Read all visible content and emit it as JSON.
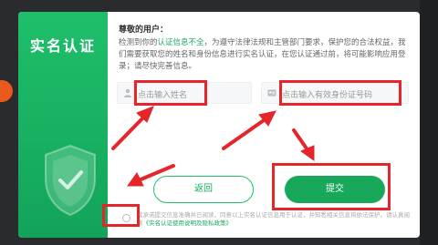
{
  "dialog": {
    "title": "实名认证",
    "greeting": "尊敬的用户：",
    "desc_prefix": "检测到你的",
    "desc_highlight": "认证信息不全",
    "desc_suffix": "，为遵守法律法规和主管部门要求，保护您的合法权益，我们需要获取您的姓名和身份信息进行实名认证，在您认证通过前，将可能影响应用登录；请尽快完善信息。"
  },
  "form": {
    "name_placeholder": "点击输入姓名",
    "id_placeholder": "点击输入有效身份证号码"
  },
  "buttons": {
    "back": "返回",
    "submit": "提交"
  },
  "agreement": {
    "prefix": "我承诺提交信息准确并已阅读，同意以上实名认证信息用于认证，并知悉相关信息将依法保护。请认真阅读",
    "link": "《实名认证使用说明及隐私政策》"
  },
  "colors": {
    "accent": "#17a85a",
    "highlight_red": "#e5252a"
  }
}
